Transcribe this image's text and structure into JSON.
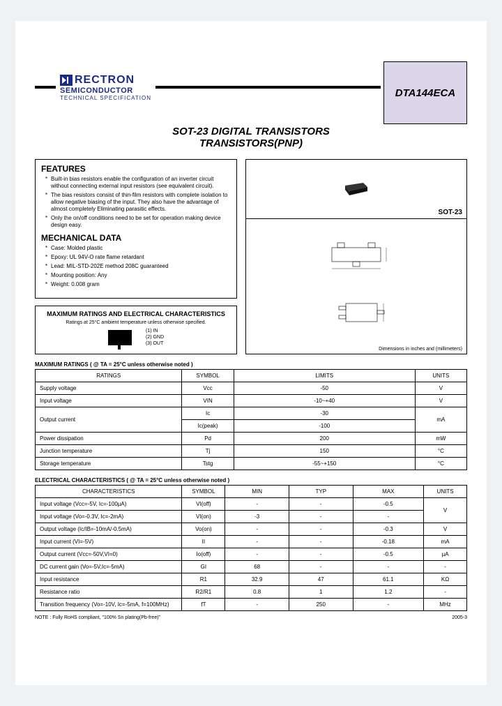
{
  "brand": {
    "name": "RECTRON",
    "sub": "SEMICONDUCTOR",
    "spec": "TECHNICAL SPECIFICATION"
  },
  "part": "DTA144ECA",
  "title_l1": "SOT-23 DIGITAL TRANSISTORS",
  "title_l2": "TRANSISTORS(PNP)",
  "features": {
    "heading": "FEATURES",
    "items": [
      "Built-in bias resistors enable the configuration of an inverter circuit without connecting external input resistors (see equivalent circuit).",
      "The bias resistors consist of thin-film resistors with complete isolation to allow negative biasing of the input. They also have the advantage of almost completely Eliminating parasitic effects.",
      "Only the on/off conditions need to be set for operation making device design easy."
    ]
  },
  "mech": {
    "heading": "MECHANICAL DATA",
    "items": [
      "Case: Molded plastic",
      "Epoxy: UL 94V-O rate flame retardant",
      "Lead: MIL-STD-202E method 208C guaranteed",
      "Mounting position: Any",
      "Weight: 0.008 gram"
    ]
  },
  "pkg": {
    "label": "SOT-23",
    "dim_note": "Dimensions in inches and (millimeters)"
  },
  "maxchar": {
    "title": "MAXIMUM RATINGS AND ELECTRICAL CHARACTERISTICS",
    "sub": "Ratings at 25°C ambient temperature unless otherwise specified.",
    "pins": [
      "(1) IN",
      "(2) GND",
      "(3) OUT"
    ]
  },
  "max_ratings": {
    "title": "MAXIMUM RATINGS ( @ TA = 25°C unless otherwise noted )",
    "headers": [
      "RATINGS",
      "SYMBOL",
      "LIMITS",
      "UNITS"
    ],
    "rows": [
      {
        "name": "Supply voltage",
        "sym": "Vcc",
        "lim": "-50",
        "unit": "V"
      },
      {
        "name": "Input voltage",
        "sym": "VIN",
        "lim": "-10~+40",
        "unit": "V"
      },
      {
        "name": "Output current",
        "sym": "Ic",
        "lim": "-30",
        "unit": "mA",
        "rowspan": 2
      },
      {
        "name": "",
        "sym": "Ic(peak)",
        "lim": "-100",
        "unit": ""
      },
      {
        "name": "Power dissipation",
        "sym": "Pd",
        "lim": "200",
        "unit": "mW"
      },
      {
        "name": "Junction temperature",
        "sym": "Tj",
        "lim": "150",
        "unit": "°C"
      },
      {
        "name": "Storage temperature",
        "sym": "Tstg",
        "lim": "-55~+150",
        "unit": "°C"
      }
    ]
  },
  "elec": {
    "title": "ELECTRICAL CHARACTERISTICS ( @ TA = 25°C unless otherwise noted )",
    "headers": [
      "CHARACTERISTICS",
      "SYMBOL",
      "MIN",
      "TYP",
      "MAX",
      "UNITS"
    ],
    "rows": [
      {
        "c": "Input voltage (Vcc=-5V, Ic=-100µA)",
        "s": "VI(off)",
        "min": "-",
        "typ": "-",
        "max": "-0.5",
        "u": "V",
        "u_rowspan": 2
      },
      {
        "c": "Input voltage (Vo=-0.3V, Ic=-2mA)",
        "s": "VI(on)",
        "min": "-3",
        "typ": "-",
        "max": "-",
        "u": ""
      },
      {
        "c": "Output voltage (Ic/IB=-10mA/-0.5mA)",
        "s": "Vo(on)",
        "min": "-",
        "typ": "-",
        "max": "-0.3",
        "u": "V"
      },
      {
        "c": "Input current (VI=-5V)",
        "s": "II",
        "min": "-",
        "typ": "-",
        "max": "-0.18",
        "u": "mA"
      },
      {
        "c": "Output current (Vcc=-50V,VI=0)",
        "s": "Io(off)",
        "min": "-",
        "typ": "-",
        "max": "-0.5",
        "u": "µA"
      },
      {
        "c": "DC current gain (Vo=-5V,Ic=-5mA)",
        "s": "GI",
        "min": "68",
        "typ": "-",
        "max": "-",
        "u": "-"
      },
      {
        "c": "Input resistance",
        "s": "R1",
        "min": "32.9",
        "typ": "47",
        "max": "61.1",
        "u": "KΩ"
      },
      {
        "c": "Resistance ratio",
        "s": "R2/R1",
        "min": "0.8",
        "typ": "1",
        "max": "1.2",
        "u": "-"
      },
      {
        "c": "Transition frequency (Vo=-10V, Ic=-5mA, f=100MHz)",
        "s": "fT",
        "min": "-",
        "typ": "250",
        "max": "-",
        "u": "MHz"
      }
    ]
  },
  "footer": {
    "note": "NOTE : Fully RoHS compliant, \"100% Sn plating(Pb-free)\"",
    "rev": "2005-3"
  }
}
